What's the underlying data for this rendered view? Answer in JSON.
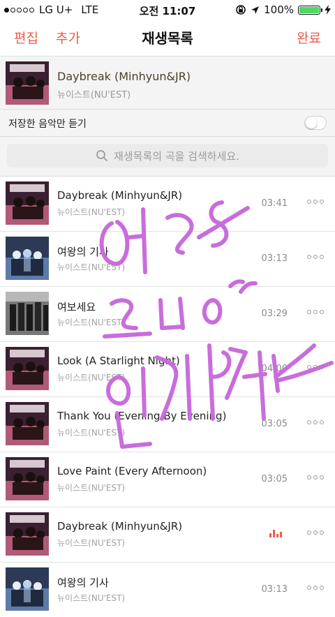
{
  "status_bar": {
    "carrier": "LG U+",
    "network": "LTE",
    "time": "오전 11:07",
    "battery": "100%",
    "battery_level": 1.0
  },
  "nav": {
    "edit_label": "편집",
    "add_label": "추가",
    "title": "재생목록",
    "done_label": "완료"
  },
  "now_playing": {
    "title": "Daybreak (Minhyun&JR)",
    "artist": "뉴이스트(NU'EST)"
  },
  "saved_only": {
    "label": "저장한 음악만 듣기",
    "on": false
  },
  "search": {
    "placeholder": "재생목록의 곡을 검색하세요."
  },
  "tracks": [
    {
      "title": "Daybreak (Minhyun&JR)",
      "artist": "뉴이스트(NU'EST)",
      "duration": "03:41",
      "art": "pink"
    },
    {
      "title": "여왕의 기사",
      "artist": "뉴이스트(NU'EST)",
      "duration": "03:13",
      "art": "blue"
    },
    {
      "title": "여보세요",
      "artist": "뉴이스트(NU'EST)",
      "duration": "03:29",
      "art": "dark"
    },
    {
      "title": "Look (A Starlight Night)",
      "artist": "뉴이스트(NU'EST)",
      "duration": "04:00",
      "art": "pink"
    },
    {
      "title": "Thank You (Evening By Evening)",
      "artist": "뉴이스트(NU'EST)",
      "duration": "03:05",
      "art": "pink"
    },
    {
      "title": "Love Paint (Every Afternoon)",
      "artist": "뉴이스트(NU'EST)",
      "duration": "03:05",
      "art": "pink"
    },
    {
      "title": "Daybreak (Minhyun&JR)",
      "artist": "뉴이스트(NU'EST)",
      "duration": "",
      "art": "pink",
      "playing": true
    },
    {
      "title": "여왕의 기사",
      "artist": "뉴이스트(NU'EST)",
      "duration": "03:13",
      "art": "blue"
    }
  ],
  "handwriting": {
    "color": "#c86ddc"
  },
  "colors": {
    "accent": "#ef5a4a",
    "battery_green": "#4cd964"
  }
}
